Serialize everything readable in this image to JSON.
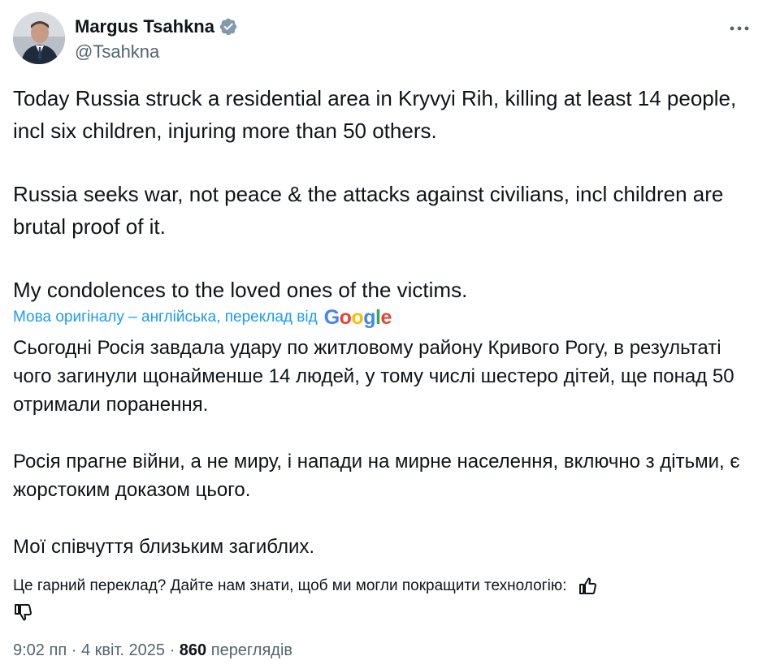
{
  "author": {
    "display_name": "Margus Tsahkna",
    "handle": "@Tsahkna"
  },
  "tweet": {
    "paragraphs": [
      "Today Russia struck a residential area in Kryvyi Rih, killing at least 14 people, incl six children, injuring more than 50 others.",
      "Russia seeks war, not peace & the attacks against civilians, incl children are brutal proof of it.",
      "My condolences to the loved ones of the victims."
    ]
  },
  "translation": {
    "source_label": "Мова оригіналу – англійська, переклад від",
    "provider": "Google",
    "paragraphs": [
      "Сьогодні Росія завдала удару по житловому району Кривого Рогу, в результаті чого загинули щонайменше 14 людей, у тому числі шестеро дітей, ще понад 50 отримали поранення.",
      "Росія прагне війни, а не миру, і напади на мирне населення, включно з дітьми, є жорстоким доказом цього.",
      "Мої співчуття близьким загиблих."
    ],
    "feedback_prompt": "Це гарний переклад? Дайте нам знати, щоб ми могли покращити технологію:"
  },
  "meta": {
    "time": "9:02 пп",
    "separator": "·",
    "date": "4 квіт. 2025",
    "views_count": "860",
    "views_label": "переглядів"
  },
  "icons": {
    "verified": "verified-badge-icon",
    "more": "more-horizontal-icon",
    "thumbs_up": "thumbs-up-icon",
    "thumbs_down": "thumbs-down-icon"
  },
  "colors": {
    "text_primary": "#0f1419",
    "text_secondary": "#536471",
    "link_blue": "#1d9bf0",
    "verified_gray": "#829aab"
  }
}
